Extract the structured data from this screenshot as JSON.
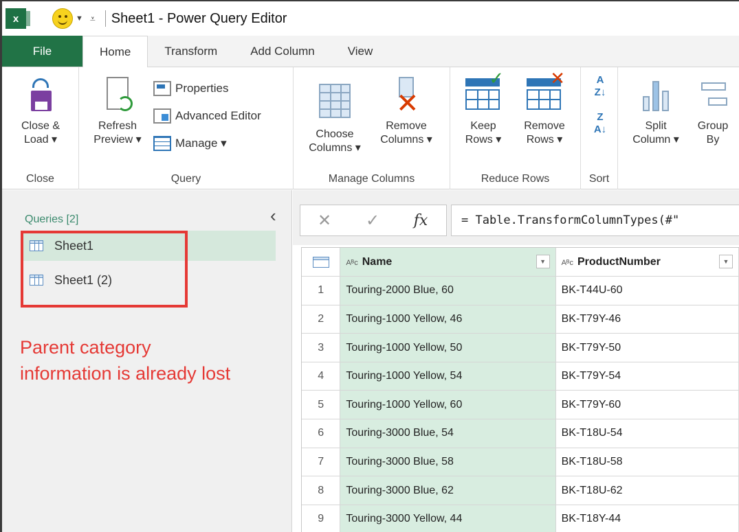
{
  "window": {
    "title": "Sheet1 - Power Query Editor"
  },
  "ribbon_tabs": [
    {
      "label": "File"
    },
    {
      "label": "Home"
    },
    {
      "label": "Transform"
    },
    {
      "label": "Add Column"
    },
    {
      "label": "View"
    }
  ],
  "ribbon": {
    "close": {
      "btn_line1": "Close &",
      "btn_line2": "Load ▾",
      "group": "Close"
    },
    "query": {
      "refresh_line1": "Refresh",
      "refresh_line2": "Preview ▾",
      "properties": "Properties",
      "advanced": "Advanced Editor",
      "manage": "Manage ▾",
      "group": "Query"
    },
    "manage_columns": {
      "choose_line1": "Choose",
      "choose_line2": "Columns ▾",
      "remove_line1": "Remove",
      "remove_line2": "Columns ▾",
      "group": "Manage Columns"
    },
    "reduce_rows": {
      "keep_line1": "Keep",
      "keep_line2": "Rows ▾",
      "remove_line1": "Remove",
      "remove_line2": "Rows ▾",
      "group": "Reduce Rows"
    },
    "sort": {
      "group": "Sort"
    },
    "transform": {
      "split_line1": "Split",
      "split_line2": "Column ▾",
      "group_line1": "Group",
      "group_line2": "By"
    }
  },
  "queries_pane": {
    "title": "Queries [2]",
    "items": [
      {
        "label": "Sheet1"
      },
      {
        "label": "Sheet1 (2)"
      }
    ]
  },
  "annotation": {
    "line1": "Parent category",
    "line2": "information is already lost"
  },
  "formula_bar": {
    "formula": "= Table.TransformColumnTypes(#\""
  },
  "table": {
    "columns": [
      {
        "type": "Aᴮᴄ",
        "name": "Name"
      },
      {
        "type": "Aᴮᴄ",
        "name": "ProductNumber"
      }
    ],
    "rows": [
      {
        "n": "1",
        "name": "Touring-2000 Blue, 60",
        "pn": "BK-T44U-60"
      },
      {
        "n": "2",
        "name": "Touring-1000 Yellow, 46",
        "pn": "BK-T79Y-46"
      },
      {
        "n": "3",
        "name": "Touring-1000 Yellow, 50",
        "pn": "BK-T79Y-50"
      },
      {
        "n": "4",
        "name": "Touring-1000 Yellow, 54",
        "pn": "BK-T79Y-54"
      },
      {
        "n": "5",
        "name": "Touring-1000 Yellow, 60",
        "pn": "BK-T79Y-60"
      },
      {
        "n": "6",
        "name": "Touring-3000 Blue, 54",
        "pn": "BK-T18U-54"
      },
      {
        "n": "7",
        "name": "Touring-3000 Blue, 58",
        "pn": "BK-T18U-58"
      },
      {
        "n": "8",
        "name": "Touring-3000 Blue, 62",
        "pn": "BK-T18U-62"
      },
      {
        "n": "9",
        "name": "Touring-3000 Yellow, 44",
        "pn": "BK-T18Y-44"
      }
    ]
  }
}
